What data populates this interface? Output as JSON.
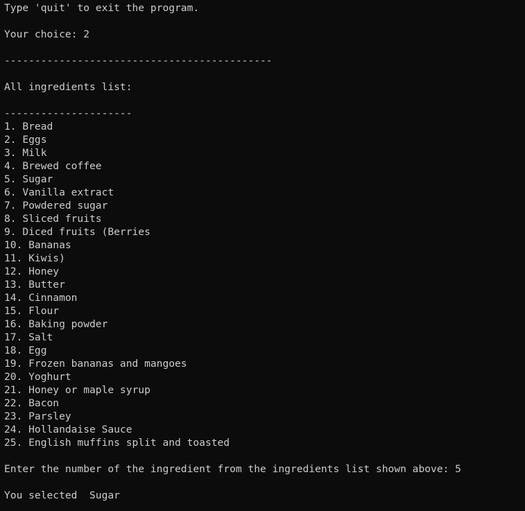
{
  "terminal": {
    "bg_color": "#0c0c0c",
    "fg_color": "#cccccc",
    "quit_hint": "Type 'quit' to exit the program.",
    "choice_prompt": "Your choice: 2",
    "separator_long": "--------------------------------------------",
    "list_title": "All ingredients list:",
    "separator_short": "---------------------",
    "ingredients": [
      "1. Bread",
      "2. Eggs",
      "3. Milk",
      "4. Brewed coffee",
      "5. Sugar",
      "6. Vanilla extract",
      "7. Powdered sugar",
      "8. Sliced fruits",
      "9. Diced fruits (Berries",
      "10. Bananas",
      "11. Kiwis)",
      "12. Honey",
      "13. Butter",
      "14. Cinnamon",
      "15. Flour",
      "16. Baking powder",
      "17. Salt",
      "18. Egg",
      "19. Frozen bananas and mangoes",
      "20. Yoghurt",
      "21. Honey or maple syrup",
      "22. Bacon",
      "23. Parsley",
      "24. Hollandaise Sauce",
      "25. English muffins split and toasted"
    ],
    "number_prompt": "Enter the number of the ingredient from the ingredients list shown above: 5",
    "selection_result": "You selected  Sugar"
  }
}
